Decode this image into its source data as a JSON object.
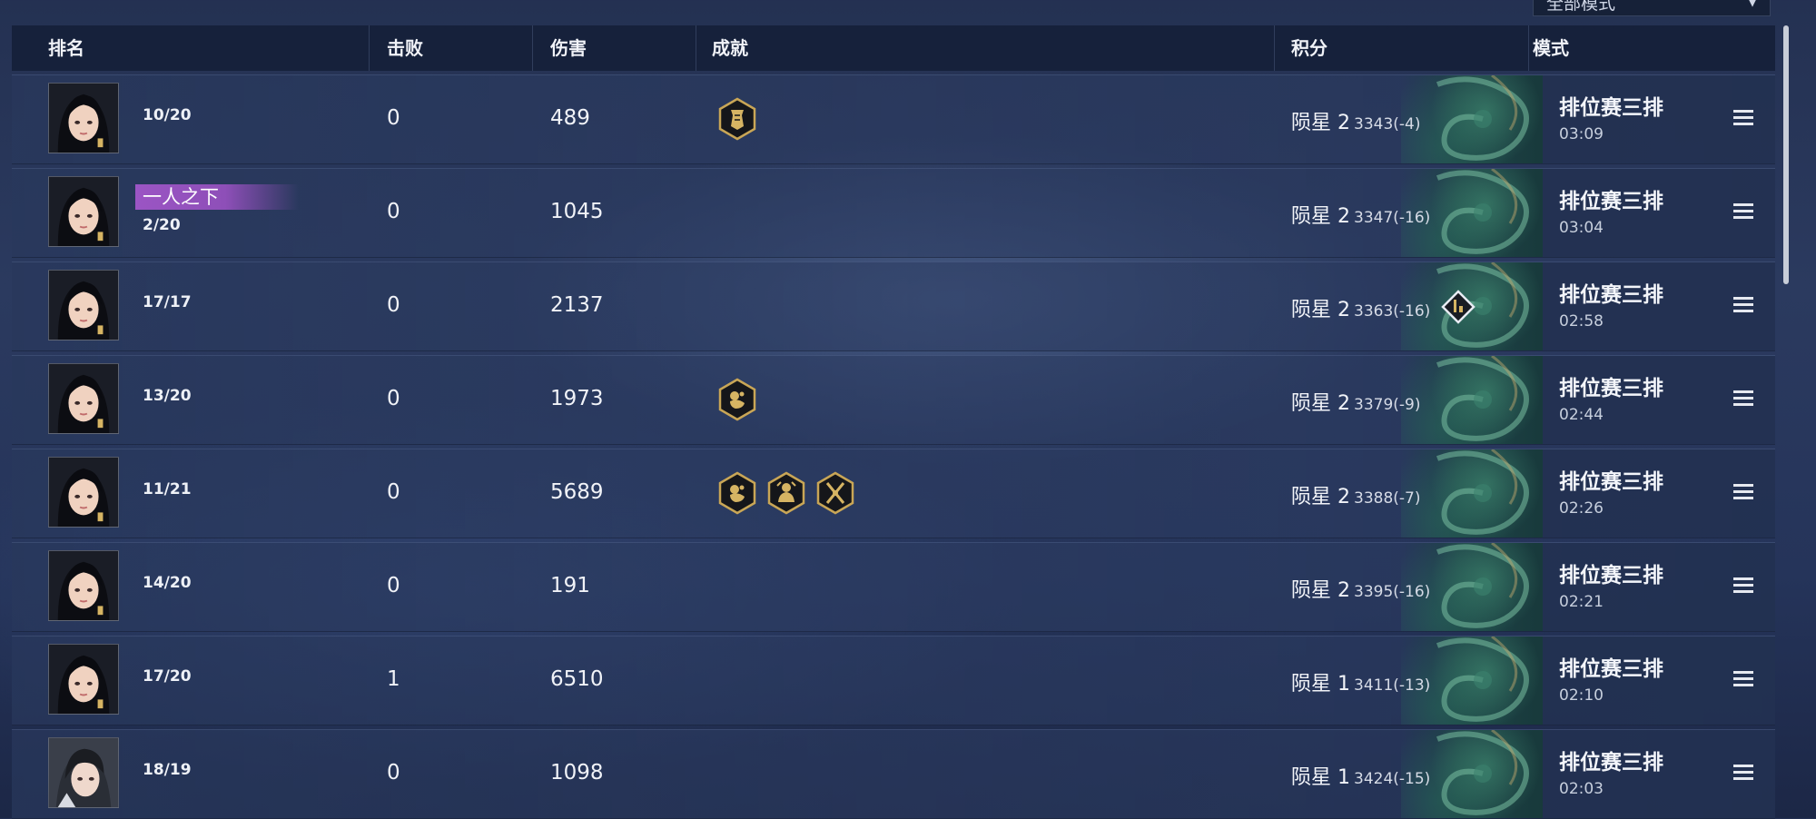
{
  "mode_filter": {
    "label": "全部模式"
  },
  "headers": {
    "rank": "排名",
    "kills": "击败",
    "damage": "伤害",
    "achievements": "成就",
    "score": "积分",
    "mode": "模式"
  },
  "rows": [
    {
      "ratio": "10/20",
      "title": "",
      "kills": "0",
      "damage": "489",
      "achievements": [
        "banner-achievement-icon"
      ],
      "rank": "陨星 2",
      "points": "3343(-4)",
      "mode": "排位赛三排",
      "time": "03:09",
      "avatar": "female-hero-avatar"
    },
    {
      "ratio": "2/20",
      "title": "一人之下",
      "kills": "0",
      "damage": "1045",
      "achievements": [],
      "rank": "陨星 2",
      "points": "3347(-16)",
      "mode": "排位赛三排",
      "time": "03:04",
      "avatar": "female-hero-avatar"
    },
    {
      "ratio": "17/17",
      "title": "",
      "kills": "0",
      "damage": "2137",
      "achievements": [],
      "rank": "陨星 2",
      "points": "3363(-16)",
      "mode": "排位赛三排",
      "time": "02:58",
      "avatar": "female-hero-avatar",
      "score_badge": "rank-diamond-icon"
    },
    {
      "ratio": "13/20",
      "title": "",
      "kills": "0",
      "damage": "1973",
      "achievements": [
        "beast-achievement-icon"
      ],
      "rank": "陨星 2",
      "points": "3379(-9)",
      "mode": "排位赛三排",
      "time": "02:44",
      "avatar": "female-hero-avatar"
    },
    {
      "ratio": "11/21",
      "title": "",
      "kills": "0",
      "damage": "5689",
      "achievements": [
        "beast-achievement-icon",
        "guardian-achievement-icon",
        "crossed-swords-achievement-icon"
      ],
      "rank": "陨星 2",
      "points": "3388(-7)",
      "mode": "排位赛三排",
      "time": "02:26",
      "avatar": "female-hero-avatar"
    },
    {
      "ratio": "14/20",
      "title": "",
      "kills": "0",
      "damage": "191",
      "achievements": [],
      "rank": "陨星 2",
      "points": "3395(-16)",
      "mode": "排位赛三排",
      "time": "02:21",
      "avatar": "female-hero-avatar"
    },
    {
      "ratio": "17/20",
      "title": "",
      "kills": "1",
      "damage": "6510",
      "achievements": [],
      "rank": "陨星 1",
      "points": "3411(-13)",
      "mode": "排位赛三排",
      "time": "02:10",
      "avatar": "female-hero-avatar"
    },
    {
      "ratio": "18/19",
      "title": "",
      "kills": "0",
      "damage": "1098",
      "achievements": [],
      "rank": "陨星 1",
      "points": "3424(-15)",
      "mode": "排位赛三排",
      "time": "02:03",
      "avatar": "male-hero-avatar"
    }
  ],
  "colors": {
    "accent_gold": "#d6b463",
    "title_purple": "#9b55c4",
    "header_bg": "#121c34"
  }
}
